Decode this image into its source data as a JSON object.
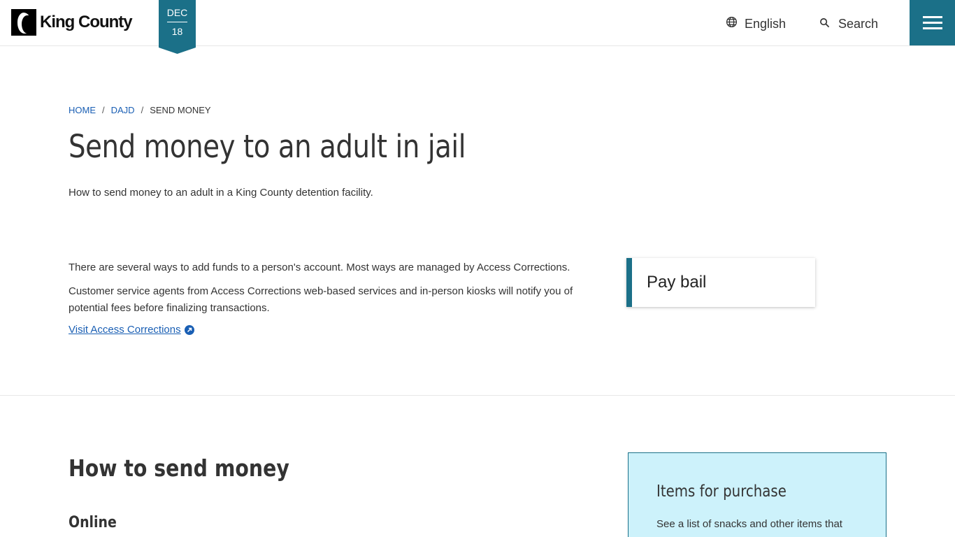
{
  "header": {
    "logo_text": "King County",
    "date_month": "DEC",
    "date_day": "18",
    "language_label": "English",
    "search_label": "Search",
    "brand_color": "#1b7088"
  },
  "breadcrumb": [
    {
      "label": "HOME"
    },
    {
      "label": "DAJD"
    },
    {
      "label": "SEND MONEY"
    }
  ],
  "page": {
    "title": "Send money to an adult in jail",
    "lede": "How to send money to an adult in a King County detention facility.",
    "intro_p1": "There are several ways to add funds to a person's account. Most ways are managed by Access Corrections.",
    "intro_p2": "Customer service agents from Access Corrections web-based services and in-person kiosks will notify you of potential fees before finalizing transactions.",
    "link_label": "Visit Access Corrections"
  },
  "side_card": {
    "label": "Pay bail"
  },
  "section": {
    "heading": "How to send money",
    "subheading": "Online"
  },
  "aside": {
    "title": "Items for purchase",
    "text": "See a list of snacks and other items that",
    "bg_color": "#cdf2fb"
  },
  "icons": [
    "king-county-logo",
    "globe-icon",
    "search-icon",
    "menu-icon",
    "external-link-icon"
  ]
}
